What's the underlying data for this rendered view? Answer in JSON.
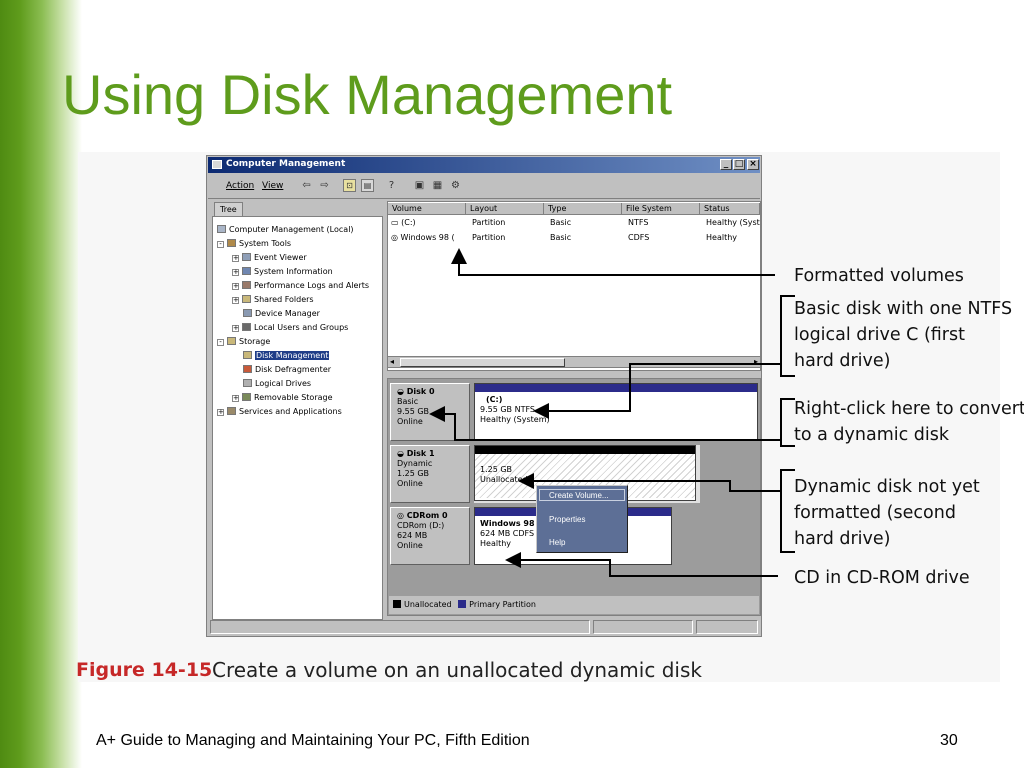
{
  "slide": {
    "title": "Using Disk Management",
    "footer_left": "A+ Guide to Managing and Maintaining Your PC, Fifth Edition",
    "page_number": "30",
    "accent_color": "#5e9c1c"
  },
  "figure": {
    "number": "Figure 14-15",
    "caption": "Create a volume on an unallocated dynamic disk"
  },
  "window": {
    "title": "Computer Management",
    "menu": [
      "Action",
      "View"
    ],
    "tree_tab": "Tree",
    "tree": [
      {
        "label": "Computer Management (Local)",
        "icon": "computer-icon"
      },
      {
        "label": "System Tools",
        "icon": "tools-icon"
      },
      {
        "label": "Event Viewer",
        "icon": "event-viewer-icon"
      },
      {
        "label": "System Information",
        "icon": "info-icon"
      },
      {
        "label": "Performance Logs and Alerts",
        "icon": "performance-icon"
      },
      {
        "label": "Shared Folders",
        "icon": "folder-icon"
      },
      {
        "label": "Device Manager",
        "icon": "device-icon"
      },
      {
        "label": "Local Users and Groups",
        "icon": "users-icon"
      },
      {
        "label": "Storage",
        "icon": "storage-icon"
      },
      {
        "label": "Disk Management",
        "icon": "disk-icon",
        "selected": true
      },
      {
        "label": "Disk Defragmenter",
        "icon": "defrag-icon"
      },
      {
        "label": "Logical Drives",
        "icon": "drive-icon"
      },
      {
        "label": "Removable Storage",
        "icon": "removable-icon"
      },
      {
        "label": "Services and Applications",
        "icon": "services-icon"
      }
    ],
    "volume_columns": [
      "Volume",
      "Layout",
      "Type",
      "File System",
      "Status"
    ],
    "volumes": [
      {
        "volume": "(C:)",
        "layout": "Partition",
        "type": "Basic",
        "fs": "NTFS",
        "status": "Healthy (Syste"
      },
      {
        "volume": "Windows 98 (",
        "layout": "Partition",
        "type": "Basic",
        "fs": "CDFS",
        "status": "Healthy"
      }
    ],
    "disks": [
      {
        "name": "Disk 0",
        "kind": "Basic",
        "size": "9.55 GB",
        "state": "Online",
        "volume_title": "(C:)",
        "volume_size": "9.55 GB NTFS",
        "volume_status": "Healthy (System)"
      },
      {
        "name": "Disk 1",
        "kind": "Dynamic",
        "size": "1.25 GB",
        "state": "Online",
        "volume_size": "1.25 GB",
        "volume_status": "Unallocated"
      },
      {
        "name": "CDRom 0",
        "kind": "CDRom (D:)",
        "size": "624 MB",
        "state": "Online",
        "volume_title": "Windows 98",
        "volume_size": "624 MB CDFS",
        "volume_status": "Healthy"
      }
    ],
    "legend": {
      "unallocated": "Unallocated",
      "primary": "Primary Partition"
    },
    "context_menu": [
      "Create Volume...",
      "Properties",
      "Help"
    ],
    "colors": {
      "primary_partition": "#2b2b8a",
      "unallocated": "#000000",
      "titlebar": "#0c2a72"
    }
  },
  "callouts": [
    {
      "lines": [
        "Formatted volumes"
      ]
    },
    {
      "lines": [
        "Basic disk with one NTFS",
        "logical drive C (first",
        "hard drive)"
      ]
    },
    {
      "lines": [
        "Right-click here to convert",
        "to a dynamic disk"
      ]
    },
    {
      "lines": [
        "Dynamic disk not yet",
        "formatted (second",
        "hard drive)"
      ]
    },
    {
      "lines": [
        "CD in CD-ROM drive"
      ]
    }
  ]
}
